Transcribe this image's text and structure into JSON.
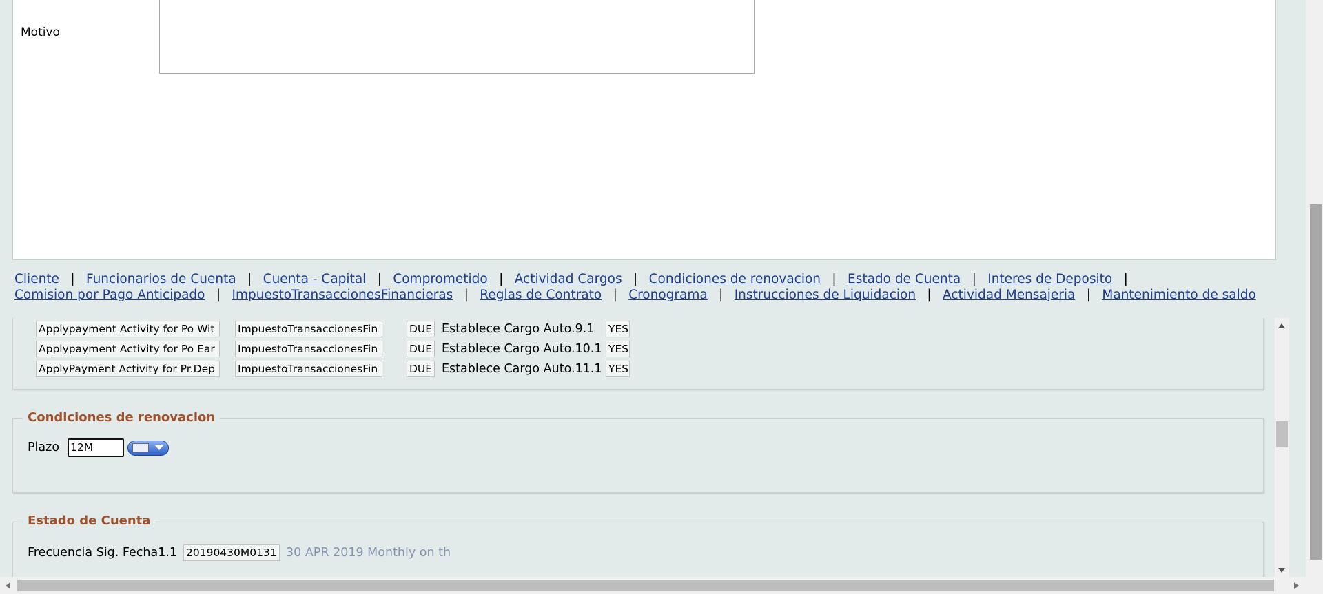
{
  "motivo": {
    "label": "Motivo",
    "value": ""
  },
  "nav": {
    "links": [
      "Cliente",
      "Funcionarios de Cuenta",
      "Cuenta - Capital",
      "Comprometido",
      "Actividad Cargos",
      "Condiciones de renovacion",
      "Estado de Cuenta",
      "Interes de Deposito",
      "Comision por Pago Anticipado",
      "ImpuestoTransaccionesFinancieras",
      "Reglas de Contrato",
      "Cronograma",
      "Instrucciones de Liquidacion",
      "Actividad Mensajeria",
      "Mantenimiento de saldo"
    ],
    "separator": "|"
  },
  "fees": [
    {
      "activity": "Applypayment Activity for Po Wit",
      "tax": "ImpuestoTransaccionesFin",
      "status": "DUE",
      "cargo": "Establece Cargo Auto.9.1",
      "flag": "YES"
    },
    {
      "activity": "Applypayment Activity for Po Ear",
      "tax": "ImpuestoTransaccionesFin",
      "status": "DUE",
      "cargo": "Establece Cargo Auto.10.1",
      "flag": "YES"
    },
    {
      "activity": "ApplyPayment Activity for Pr.Dep",
      "tax": "ImpuestoTransaccionesFin",
      "status": "DUE",
      "cargo": "Establece Cargo Auto.11.1",
      "flag": "YES"
    }
  ],
  "renovacion": {
    "legend": "Condiciones de renovacion",
    "plazo_label": "Plazo",
    "plazo_value": "12M",
    "picker_icon": "calendar-dropdown-icon"
  },
  "estado": {
    "legend": "Estado de Cuenta",
    "freq_label": "Frecuencia Sig. Fecha1.1",
    "freq_value": "20190430M0131",
    "freq_desc": "30 APR 2019 Monthly on th"
  },
  "colors": {
    "link": "#1f3e8c",
    "legend": "#a0522d",
    "background": "#e2ebe9"
  }
}
